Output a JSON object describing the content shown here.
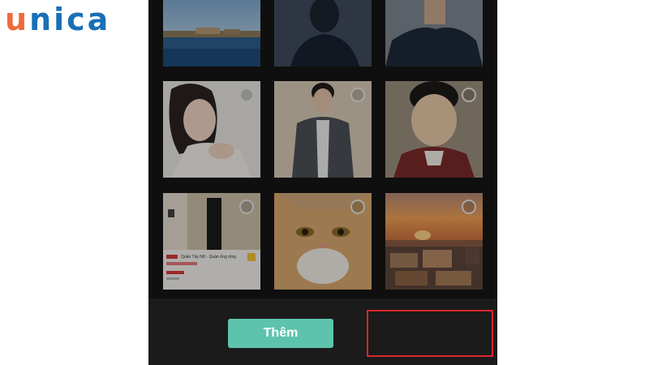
{
  "logo": {
    "part1": "u",
    "part2": "nica"
  },
  "gallery": {
    "add_button_label": "Thêm",
    "items": [
      {
        "name": "beach-resort-photo",
        "selected": false
      },
      {
        "name": "silhouette-person-photo",
        "selected": false
      },
      {
        "name": "man-dark-shirt-photo",
        "selected": false
      },
      {
        "name": "woman-portrait-photo",
        "selected": false
      },
      {
        "name": "man-suit-photo",
        "selected": false
      },
      {
        "name": "boy-portrait-photo",
        "selected": false
      },
      {
        "name": "shop-listing-screenshot",
        "selected": false
      },
      {
        "name": "cat-closeup-photo",
        "selected": false
      },
      {
        "name": "sunset-food-photo",
        "selected": false
      }
    ]
  },
  "colors": {
    "logo_orange": "#ee6a3a",
    "logo_blue": "#1a6fb5",
    "accent_teal": "#5ec3ad",
    "highlight_red": "#d8262b",
    "background_dark": "#161616"
  }
}
